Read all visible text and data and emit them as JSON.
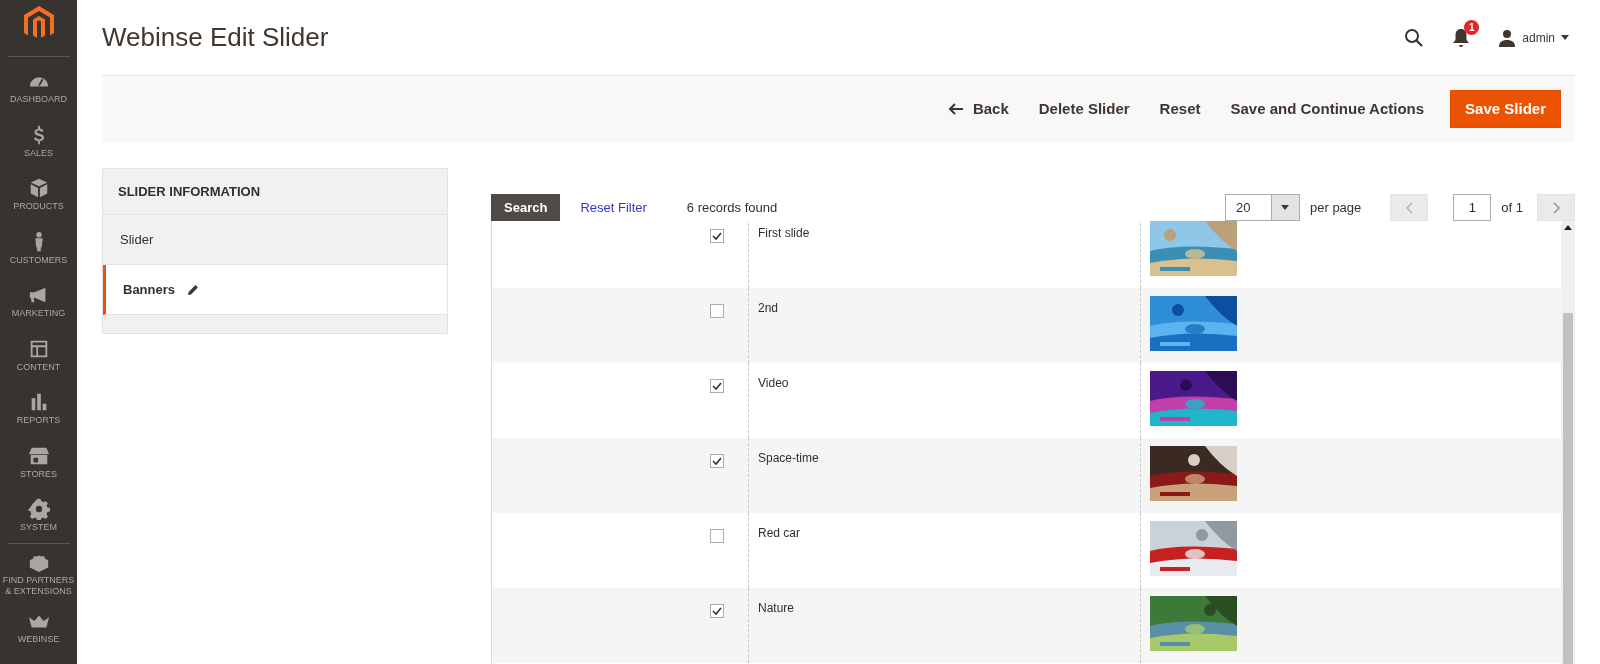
{
  "sidebar": {
    "items": [
      {
        "label": "DASHBOARD"
      },
      {
        "label": "SALES"
      },
      {
        "label": "PRODUCTS"
      },
      {
        "label": "CUSTOMERS"
      },
      {
        "label": "MARKETING"
      },
      {
        "label": "CONTENT"
      },
      {
        "label": "REPORTS"
      },
      {
        "label": "STORES"
      },
      {
        "label": "SYSTEM"
      },
      {
        "label": "FIND PARTNERS & EXTENSIONS"
      },
      {
        "label": "WEBINSE"
      }
    ]
  },
  "page_title": "Webinse Edit Slider",
  "header": {
    "notification_count": "1",
    "user": "admin"
  },
  "actions": [
    {
      "label": "Back",
      "kind": "back"
    },
    {
      "label": "Delete Slider",
      "kind": "plain"
    },
    {
      "label": "Reset",
      "kind": "plain"
    },
    {
      "label": "Save and Continue Actions",
      "kind": "plain"
    },
    {
      "label": "Save Slider",
      "kind": "primary"
    }
  ],
  "tabs_panel": {
    "title": "SLIDER INFORMATION",
    "tabs": [
      {
        "label": "Slider",
        "selected": false,
        "edited": false
      },
      {
        "label": "Banners",
        "selected": true,
        "edited": true
      }
    ]
  },
  "grid": {
    "search_button": "Search",
    "reset_filter": "Reset Filter",
    "records": "6 records found",
    "per_page_value": "20",
    "per_page_label": "per page",
    "page": "1",
    "page_total": "of 1",
    "rows": [
      {
        "title": "First slide",
        "checked": true
      },
      {
        "title": "2nd",
        "checked": false
      },
      {
        "title": "Video",
        "checked": true
      },
      {
        "title": "Space-time",
        "checked": true
      },
      {
        "title": "Red car",
        "checked": false
      },
      {
        "title": "Nature",
        "checked": true
      }
    ]
  }
}
